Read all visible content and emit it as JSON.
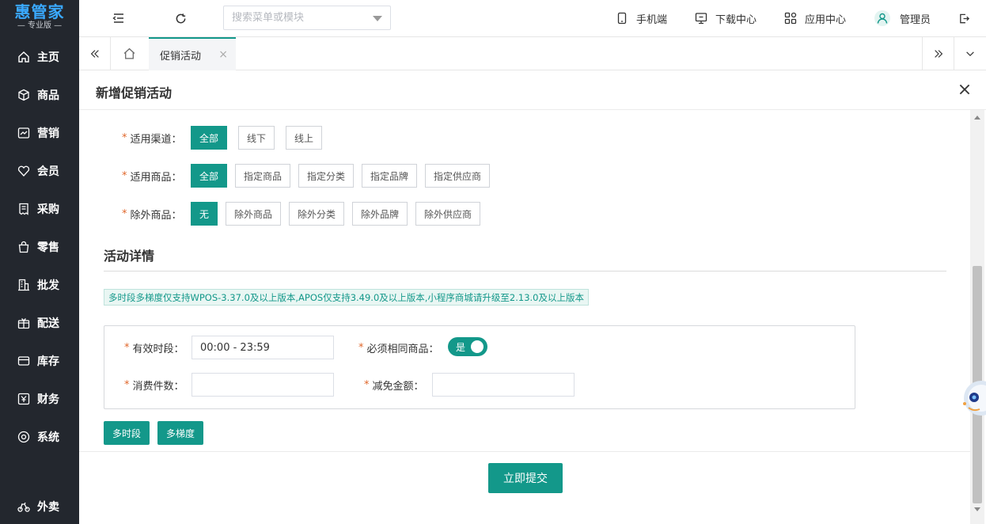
{
  "brand": {
    "name": "惠管家",
    "edition": "— 专业版 —"
  },
  "sidebar": {
    "items": [
      {
        "label": "主页",
        "icon": "home-icon"
      },
      {
        "label": "商品",
        "icon": "box-icon"
      },
      {
        "label": "营销",
        "icon": "chart-icon"
      },
      {
        "label": "会员",
        "icon": "heart-icon"
      },
      {
        "label": "采购",
        "icon": "receipt-icon"
      },
      {
        "label": "零售",
        "icon": "bag-icon"
      },
      {
        "label": "批发",
        "icon": "building-icon"
      },
      {
        "label": "配送",
        "icon": "gift-icon"
      },
      {
        "label": "库存",
        "icon": "card-icon"
      },
      {
        "label": "财务",
        "icon": "yen-icon"
      },
      {
        "label": "系统",
        "icon": "settings-icon"
      }
    ],
    "bottom": {
      "label": "外卖",
      "icon": "bike-icon"
    }
  },
  "topbar": {
    "search_placeholder": "搜索菜单或模块",
    "mobile": "手机端",
    "download": "下载中心",
    "apps": "应用中心",
    "user": "管理员"
  },
  "tabs": {
    "active": "促销活动",
    "close": "×"
  },
  "panel": {
    "title": "新增促销活动",
    "channel": {
      "label": "适用渠道：",
      "options": [
        "全部",
        "线下",
        "线上"
      ]
    },
    "goods": {
      "label": "适用商品：",
      "options": [
        "全部",
        "指定商品",
        "指定分类",
        "指定品牌",
        "指定供应商"
      ]
    },
    "exclude": {
      "label": "除外商品：",
      "options": [
        "无",
        "除外商品",
        "除外分类",
        "除外品牌",
        "除外供应商"
      ]
    },
    "detail_title": "活动详情",
    "notice": "多时段多梯度仅支持WPOS-3.37.0及以上版本,APOS仅支持3.49.0及以上版本,小程序商城请升级至2.13.0及以上版本",
    "tier": {
      "period_label": "有效时段：",
      "period_value": "00:00 - 23:59",
      "same_goods_label": "必须相同商品：",
      "same_goods_toggle": "是",
      "qty_label": "消费件数：",
      "qty_value": "",
      "discount_label": "减免金额：",
      "discount_value": ""
    },
    "multi_period": "多时段",
    "multi_tier": "多梯度",
    "submit": "立即提交"
  },
  "colors": {
    "primary": "#13988a",
    "sidebar": "#23272e",
    "required": "#e0672b"
  }
}
